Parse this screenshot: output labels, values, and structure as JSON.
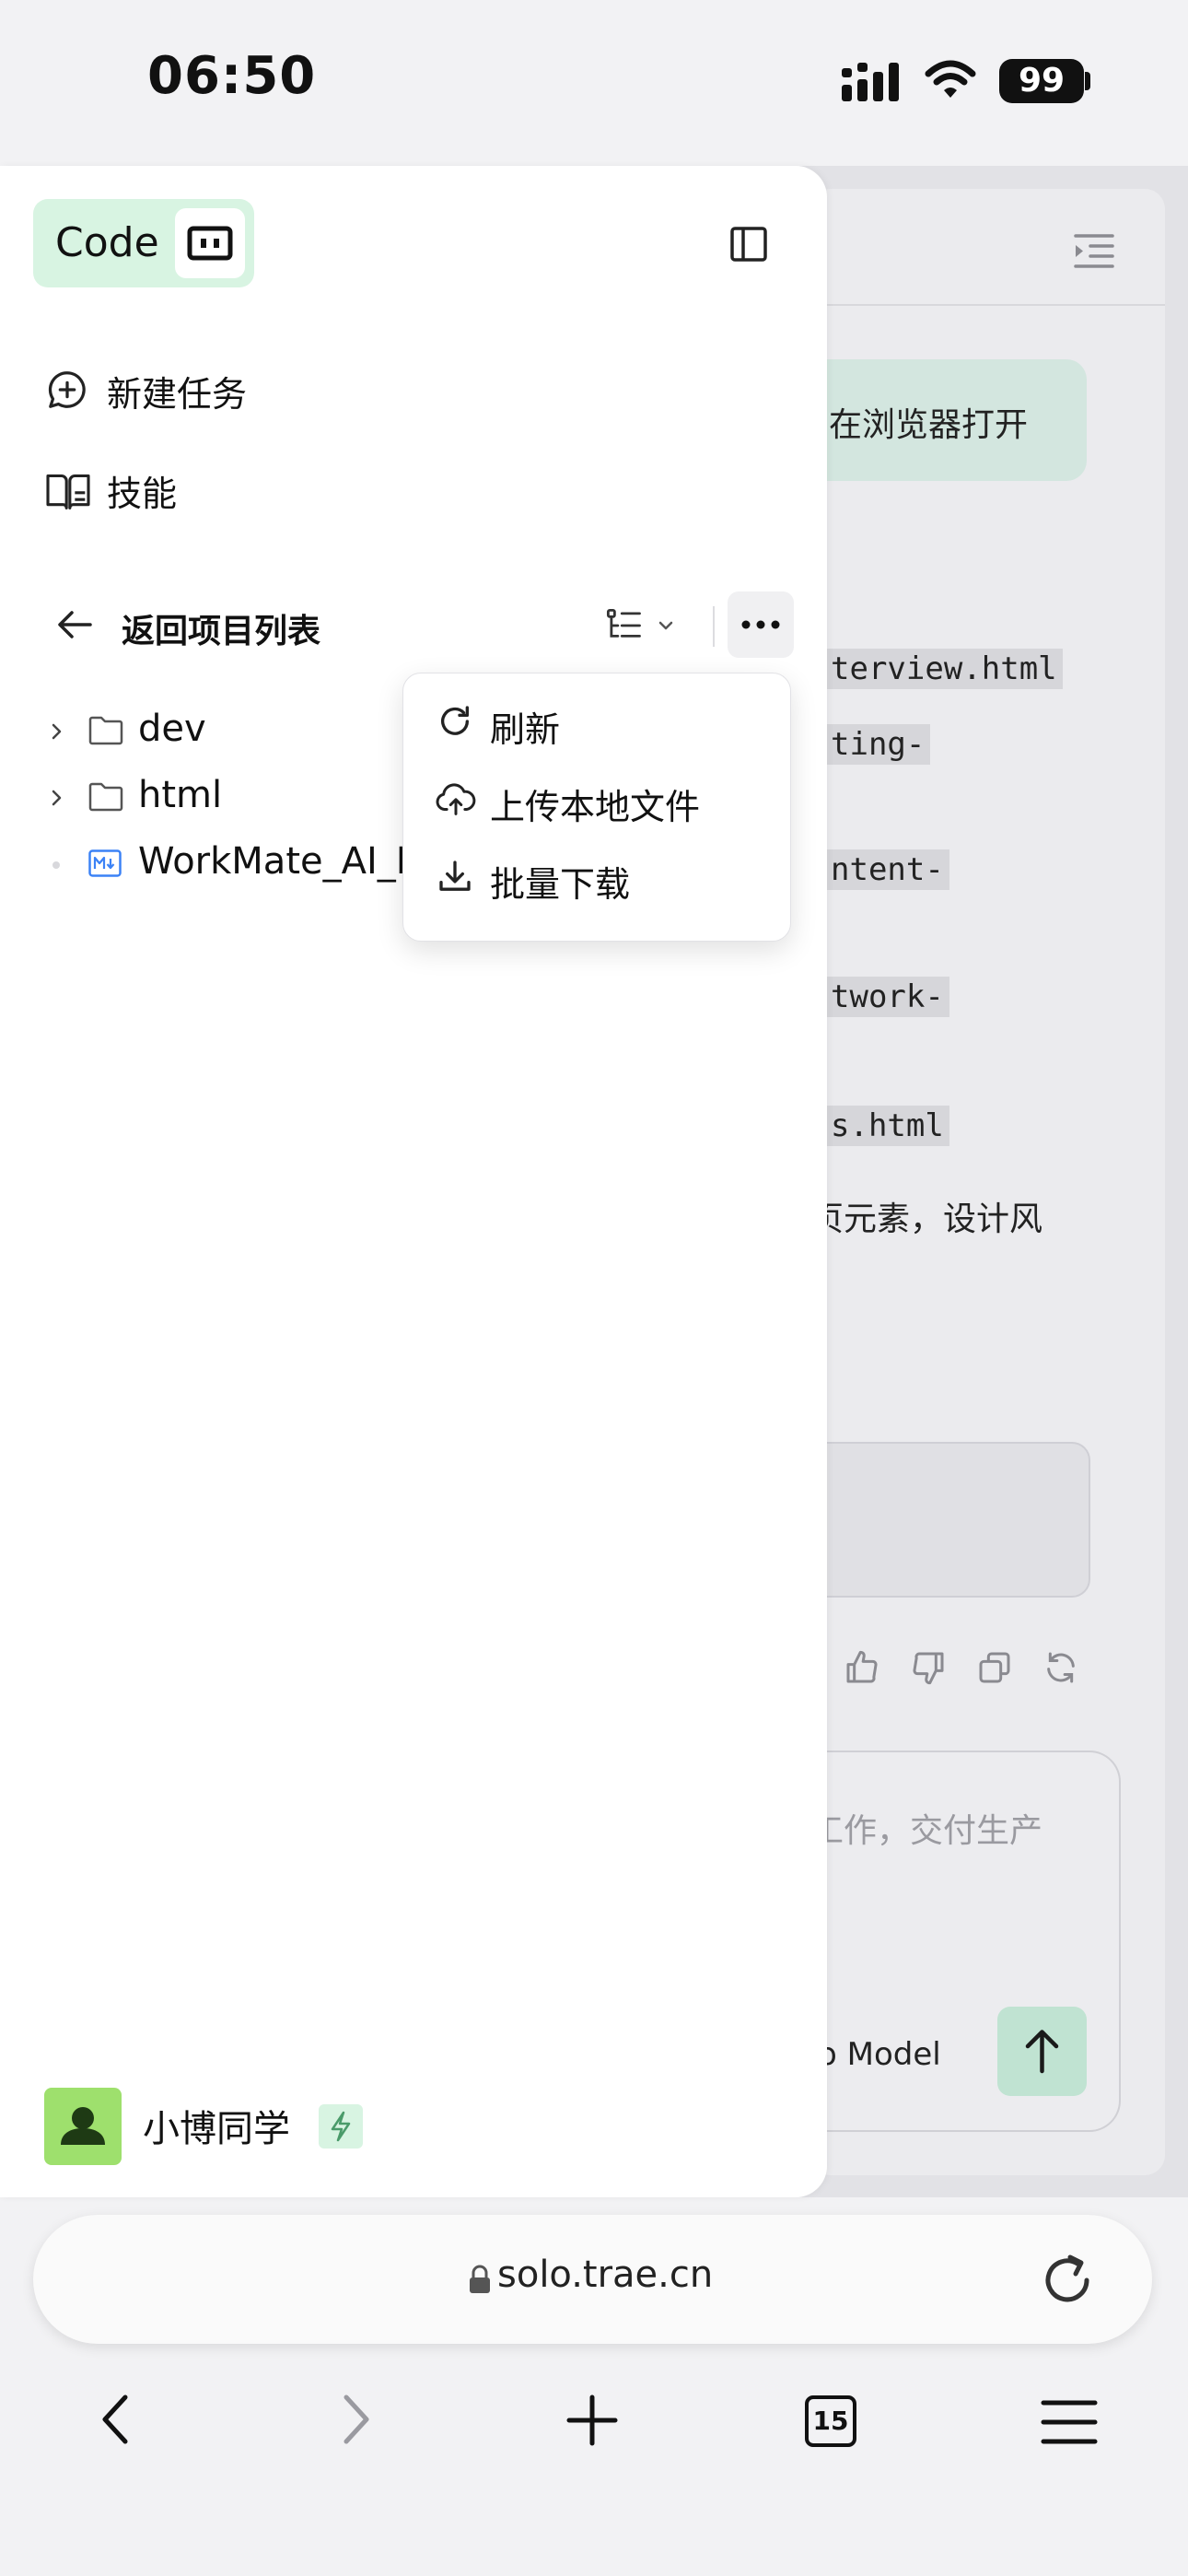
{
  "status_bar": {
    "time": "06:50",
    "battery": "99"
  },
  "background_app": {
    "open_in_browser": "在浏览器打开",
    "file_chips": [
      "terview.html",
      "ting-",
      "ntent-",
      "twork-",
      "s.html"
    ],
    "description_fragment": "页元素，设计风",
    "composer_placeholder": "工作，交付生产",
    "model_label": "o Model"
  },
  "sidebar": {
    "app_badge": "Code",
    "nav": [
      {
        "label": "新建任务",
        "icon": "chat-plus-icon"
      },
      {
        "label": "技能",
        "icon": "book-icon"
      }
    ],
    "project_back": "返回项目列表",
    "tree": [
      {
        "label": "dev",
        "type": "folder"
      },
      {
        "label": "html",
        "type": "folder"
      },
      {
        "label": "WorkMate_AI_I",
        "type": "markdown-file"
      }
    ],
    "more_menu": [
      {
        "label": "刷新",
        "icon": "refresh-icon"
      },
      {
        "label": "上传本地文件",
        "icon": "cloud-upload-icon"
      },
      {
        "label": "批量下载",
        "icon": "download-icon"
      }
    ],
    "user": {
      "name": "小博同学"
    }
  },
  "browser": {
    "url": "solo.trae.cn",
    "tab_count": "15"
  },
  "colors": {
    "accent_green": "#d8f4e2",
    "send_button": "#c0e3d2",
    "avatar_bg": "#9ee06d",
    "markdown_icon": "#3b82f6"
  }
}
